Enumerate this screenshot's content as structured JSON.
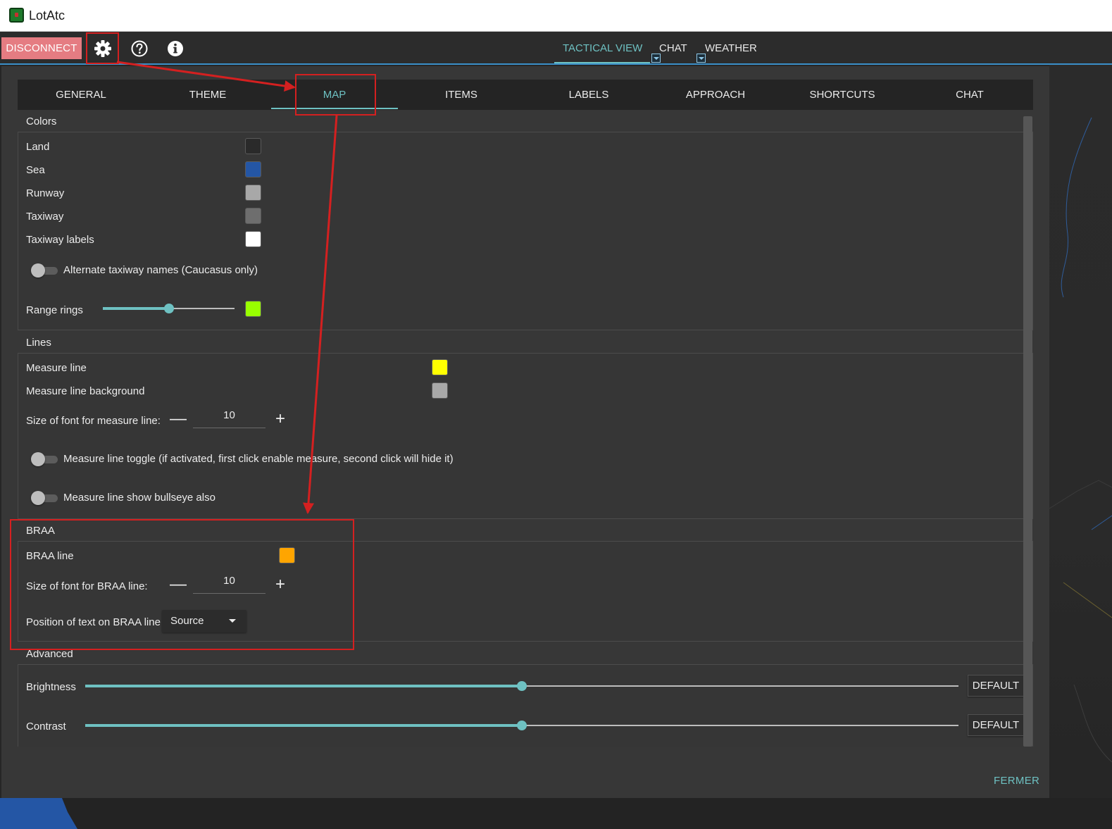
{
  "window": {
    "title": "LotAtc"
  },
  "toolbar": {
    "disconnect_label": "DISCONNECT",
    "tabs": [
      {
        "label": "TACTICAL VIEW",
        "active": true
      },
      {
        "label": "CHAT",
        "active": false
      },
      {
        "label": "WEATHER",
        "active": false
      }
    ]
  },
  "settings_tabs": [
    {
      "label": "GENERAL"
    },
    {
      "label": "THEME"
    },
    {
      "label": "MAP",
      "active": true
    },
    {
      "label": "ITEMS"
    },
    {
      "label": "LABELS"
    },
    {
      "label": "APPROACH"
    },
    {
      "label": "SHORTCUTS"
    },
    {
      "label": "CHAT"
    }
  ],
  "colors": {
    "title": "Colors",
    "items": [
      {
        "label": "Land",
        "color": "#2a2a2a"
      },
      {
        "label": "Sea",
        "color": "#2456a5"
      },
      {
        "label": "Runway",
        "color": "#a8a8a8"
      },
      {
        "label": "Taxiway",
        "color": "#6e6e6e"
      },
      {
        "label": "Taxiway labels",
        "color": "#ffffff"
      }
    ],
    "alt_taxiway_label": "Alternate taxiway names (Caucasus only)",
    "alt_taxiway_enabled": false,
    "range_rings_label": "Range rings",
    "range_rings_value_pct": 50,
    "range_rings_color": "#99ff00"
  },
  "lines": {
    "title": "Lines",
    "measure_line_label": "Measure line",
    "measure_line_color": "#ffff00",
    "measure_line_bg_label": "Measure line background",
    "measure_line_bg_color": "#a8a8a8",
    "font_size_label": "Size of font for measure line:",
    "font_size_value": "10",
    "toggle_label": "Measure line toggle (if activated, first click enable measure, second click will hide it)",
    "toggle_enabled": false,
    "bullseye_label": "Measure line show bullseye also",
    "bullseye_enabled": false
  },
  "braa": {
    "title": "BRAA",
    "line_label": "BRAA line",
    "line_color": "#ffa500",
    "font_size_label": "Size of font for BRAA line:",
    "font_size_value": "10",
    "position_label": "Position of text on BRAA line",
    "position_value": "Source"
  },
  "advanced": {
    "title": "Advanced",
    "brightness_label": "Brightness",
    "brightness_pct": 50,
    "contrast_label": "Contrast",
    "contrast_pct": 50,
    "default_label": "DEFAULT"
  },
  "footer": {
    "close_label": "FERMER"
  }
}
